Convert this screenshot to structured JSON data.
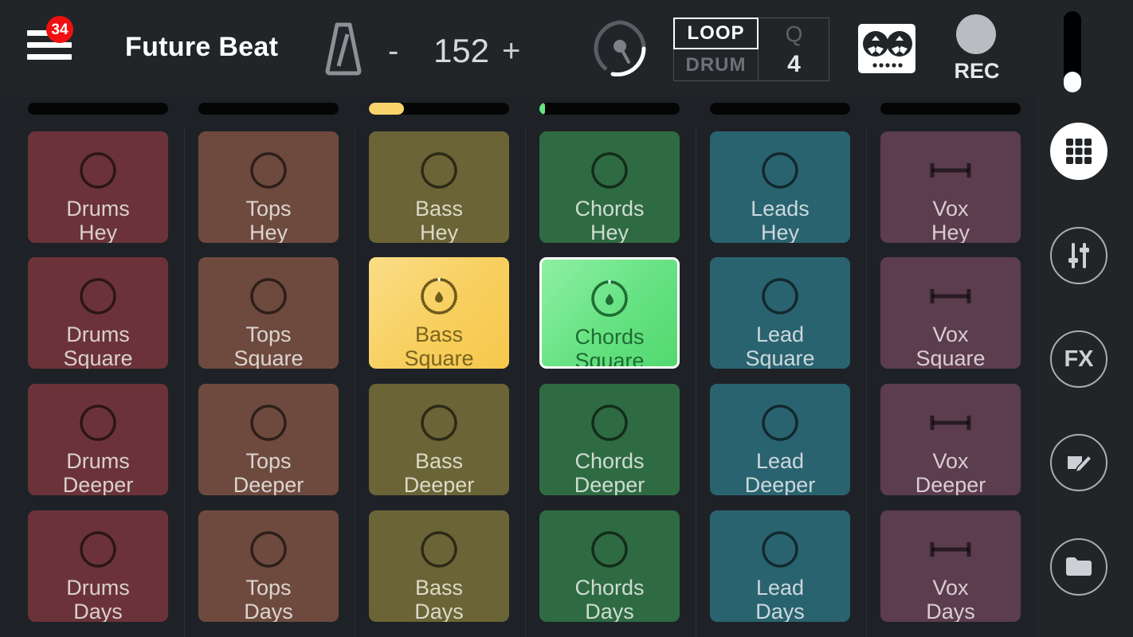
{
  "header": {
    "menu_icon": "hamburger-menu-icon",
    "menu_badge": "34",
    "project_title": "Future Beat",
    "metronome_icon": "metronome-icon",
    "tempo_decrement": "-",
    "tempo_value": "152",
    "tempo_increment": "+",
    "knob_icon": "circular-dial-icon",
    "loop_label": "LOOP",
    "drum_label": "DRUM",
    "quantize_label": "Q",
    "quantize_value": "4",
    "tape_icon": "cassette-tape-icon",
    "rec_label": "REC",
    "volume_slider": "vertical-volume-slider"
  },
  "sidebar": {
    "items": [
      {
        "name": "grid-view-button",
        "icon": "grid-icon",
        "active": true
      },
      {
        "name": "mixer-button",
        "icon": "faders-icon",
        "active": false
      },
      {
        "name": "fx-button",
        "icon": "fx-icon",
        "label": "FX",
        "active": false
      },
      {
        "name": "edit-button",
        "icon": "pencil-edit-icon",
        "active": false
      },
      {
        "name": "files-button",
        "icon": "folder-icon",
        "active": false
      }
    ]
  },
  "colors": {
    "background": "#1e2227",
    "header_bg": "#212528",
    "badge_red": "#ef1111",
    "active_yellow": "#fad46b",
    "active_green": "#67e283",
    "progress_black": "#050505",
    "selection_white": "#ffffff"
  },
  "progress_bars": [
    {
      "track": "Drums",
      "percent": 0,
      "color": "#fad46b"
    },
    {
      "track": "Tops",
      "percent": 0,
      "color": "#fad46b"
    },
    {
      "track": "Bass",
      "percent": 25,
      "color": "#fad46b"
    },
    {
      "track": "Chords",
      "percent": 4,
      "color": "#67e283"
    },
    {
      "track": "Leads",
      "percent": 0,
      "color": "#fad46b"
    },
    {
      "track": "Vox",
      "percent": 0,
      "color": "#fad46b"
    }
  ],
  "grid": {
    "columns": [
      {
        "track": "Drums",
        "base_color": "#6b3339",
        "icon": "loop-circle-icon",
        "text_color": "#d8d0cd"
      },
      {
        "track": "Tops",
        "base_color": "#6e4a3e",
        "icon": "loop-circle-icon",
        "text_color": "#dcd4cf"
      },
      {
        "track": "Bass",
        "base_color": "#6b6436",
        "icon": "loop-circle-icon",
        "text_color": "#dcd9c8"
      },
      {
        "track": "Chords",
        "base_color": "#2f6b42",
        "icon": "loop-circle-icon",
        "text_color": "#cfdcd2"
      },
      {
        "track": "Leads",
        "base_color": "#2a6370",
        "icon": "loop-circle-icon",
        "text_color": "#ccd8dc"
      },
      {
        "track": "Vox",
        "base_color": "#5b3d4d",
        "icon": "oneshot-bar-icon",
        "text_color": "#d9ccd2"
      }
    ],
    "cells": [
      [
        {
          "line1": "Drums",
          "line2": "Hey",
          "state": "idle"
        },
        {
          "line1": "Tops",
          "line2": "Hey",
          "state": "idle"
        },
        {
          "line1": "Bass",
          "line2": "Hey",
          "state": "idle"
        },
        {
          "line1": "Chords",
          "line2": "Hey",
          "state": "idle"
        },
        {
          "line1": "Leads",
          "line2": "Hey",
          "state": "idle"
        },
        {
          "line1": "Vox",
          "line2": "Hey",
          "state": "idle"
        }
      ],
      [
        {
          "line1": "Drums",
          "line2": "Square",
          "state": "idle"
        },
        {
          "line1": "Tops",
          "line2": "Square",
          "state": "idle"
        },
        {
          "line1": "Bass",
          "line2": "Square",
          "state": "queued"
        },
        {
          "line1": "Chords",
          "line2": "Square",
          "state": "playing-selected"
        },
        {
          "line1": "Lead",
          "line2": "Square",
          "state": "idle"
        },
        {
          "line1": "Vox",
          "line2": "Square",
          "state": "idle"
        }
      ],
      [
        {
          "line1": "Drums",
          "line2": "Deeper",
          "state": "idle"
        },
        {
          "line1": "Tops",
          "line2": "Deeper",
          "state": "idle"
        },
        {
          "line1": "Bass",
          "line2": "Deeper",
          "state": "idle"
        },
        {
          "line1": "Chords",
          "line2": "Deeper",
          "state": "idle"
        },
        {
          "line1": "Lead",
          "line2": "Deeper",
          "state": "idle"
        },
        {
          "line1": "Vox",
          "line2": "Deeper",
          "state": "idle"
        }
      ],
      [
        {
          "line1": "Drums",
          "line2": "Days",
          "state": "idle"
        },
        {
          "line1": "Tops",
          "line2": "Days",
          "state": "idle"
        },
        {
          "line1": "Bass",
          "line2": "Days",
          "state": "idle"
        },
        {
          "line1": "Chords",
          "line2": "Days",
          "state": "idle"
        },
        {
          "line1": "Lead",
          "line2": "Days",
          "state": "idle"
        },
        {
          "line1": "Vox",
          "line2": "Days",
          "state": "idle"
        }
      ]
    ]
  }
}
